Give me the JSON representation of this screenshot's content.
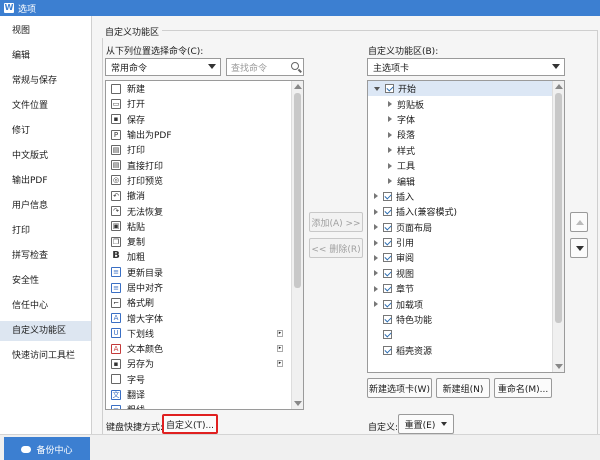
{
  "window": {
    "title": "选项",
    "icon_letter": "W"
  },
  "sidebar": {
    "items": [
      {
        "label": "视图"
      },
      {
        "label": "编辑"
      },
      {
        "label": "常规与保存"
      },
      {
        "label": "文件位置"
      },
      {
        "label": "修订"
      },
      {
        "label": "中文版式"
      },
      {
        "label": "输出PDF"
      },
      {
        "label": "用户信息"
      },
      {
        "label": "打印"
      },
      {
        "label": "拼写检查"
      },
      {
        "label": "安全性"
      },
      {
        "label": "信任中心"
      },
      {
        "label": "自定义功能区"
      },
      {
        "label": "快速访问工具栏"
      }
    ],
    "active_index": 12,
    "backup_label": "备份中心"
  },
  "main": {
    "group_title": "自定义功能区",
    "left": {
      "label": "从下列位置选择命令(C):",
      "select_value": "常用命令",
      "search_placeholder": "查找命令",
      "commands": [
        {
          "label": "新建",
          "icon": "new-doc-icon",
          "glyph": ""
        },
        {
          "label": "打开",
          "icon": "folder-open-icon",
          "glyph": "▭"
        },
        {
          "label": "保存",
          "icon": "save-icon",
          "glyph": "▪"
        },
        {
          "label": "输出为PDF",
          "icon": "pdf-icon",
          "glyph": "P"
        },
        {
          "label": "打印",
          "icon": "printer-icon",
          "glyph": "▤"
        },
        {
          "label": "直接打印",
          "icon": "quick-print-icon",
          "glyph": "▤"
        },
        {
          "label": "打印预览",
          "icon": "print-preview-icon",
          "glyph": "◎"
        },
        {
          "label": "撤消",
          "icon": "undo-icon",
          "glyph": "↶"
        },
        {
          "label": "无法恢复",
          "icon": "redo-icon",
          "glyph": "↷"
        },
        {
          "label": "粘贴",
          "icon": "paste-icon",
          "glyph": "▣"
        },
        {
          "label": "复制",
          "icon": "copy-icon",
          "glyph": "❐"
        },
        {
          "label": "加粗",
          "icon": "bold-icon",
          "glyph": "B"
        },
        {
          "label": "更新目录",
          "icon": "update-toc-icon",
          "glyph": "≡"
        },
        {
          "label": "居中对齐",
          "icon": "align-center-icon",
          "glyph": "≡"
        },
        {
          "label": "格式刷",
          "icon": "format-painter-icon",
          "glyph": "⌐"
        },
        {
          "label": "增大字体",
          "icon": "grow-font-icon",
          "glyph": "A"
        },
        {
          "label": "下划线",
          "icon": "underline-icon",
          "glyph": "U"
        },
        {
          "label": "文本颜色",
          "icon": "font-color-icon",
          "glyph": "A"
        },
        {
          "label": "另存为",
          "icon": "save-as-icon",
          "glyph": "▪"
        },
        {
          "label": "字号",
          "icon": "font-size-icon",
          "glyph": ""
        },
        {
          "label": "翻译",
          "icon": "translate-icon",
          "glyph": "文"
        },
        {
          "label": "粗线",
          "icon": "thick-line-icon",
          "glyph": "≡"
        }
      ],
      "submenu_rows": [
        16,
        17,
        18
      ]
    },
    "shortcut_label": "键盘快捷方式:",
    "customize_button": "自定义(T)...",
    "add_button": "添加(A) >>",
    "remove_button": "<< 删除(R)",
    "right": {
      "label": "自定义功能区(B):",
      "select_value": "主选项卡",
      "tree": [
        {
          "label": "开始",
          "level": 0,
          "expanded": true,
          "checked": true,
          "selected": true
        },
        {
          "label": "剪贴板",
          "level": 1
        },
        {
          "label": "字体",
          "level": 1
        },
        {
          "label": "段落",
          "level": 1
        },
        {
          "label": "样式",
          "level": 1
        },
        {
          "label": "工具",
          "level": 1
        },
        {
          "label": "编辑",
          "level": 1
        },
        {
          "label": "插入",
          "level": 0,
          "checked": true
        },
        {
          "label": "插入(兼容模式)",
          "level": 0,
          "checked": true
        },
        {
          "label": "页面布局",
          "level": 0,
          "checked": true
        },
        {
          "label": "引用",
          "level": 0,
          "checked": true
        },
        {
          "label": "审阅",
          "level": 0,
          "checked": true
        },
        {
          "label": "视图",
          "level": 0,
          "checked": true
        },
        {
          "label": "章节",
          "level": 0,
          "checked": true
        },
        {
          "label": "加载项",
          "level": 0,
          "checked": true
        },
        {
          "label": "特色功能",
          "level": 0,
          "checked": true,
          "no_expander": true
        },
        {
          "label": "",
          "level": 0,
          "checked": true,
          "no_expander": true
        },
        {
          "label": "稻壳资源",
          "level": 0,
          "checked": true,
          "no_expander": true
        }
      ],
      "new_tab_button": "新建选项卡(W)",
      "new_group_button": "新建组(N)",
      "rename_button": "重命名(M)...",
      "customize_label": "自定义:",
      "reset_button": "重置(E)"
    }
  }
}
